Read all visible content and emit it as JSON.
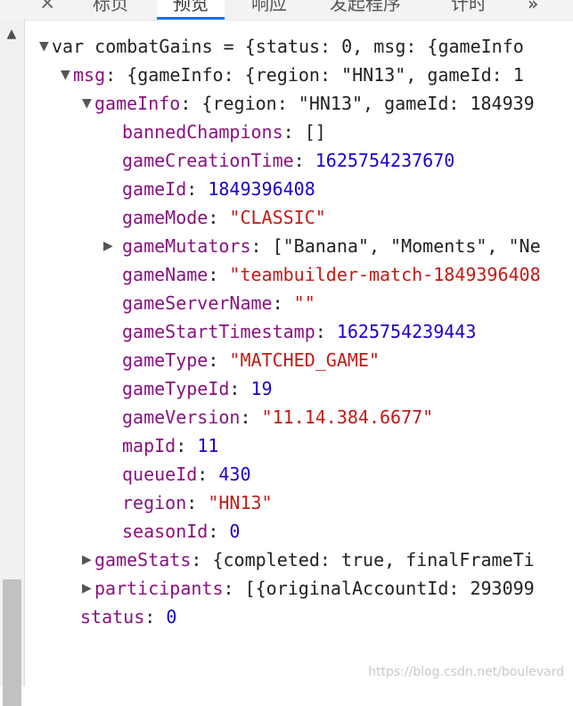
{
  "tabs": {
    "close_glyph": "×",
    "items": [
      "标页",
      "预览",
      "响应",
      "发起程序",
      "计时"
    ],
    "more_glyph": "»"
  },
  "scroll": {
    "up_glyph": "▲"
  },
  "console": {
    "root_line": "var combatGains = {status: 0, msg: {gameInfo",
    "msg": {
      "key": "msg",
      "preview": "{gameInfo: {region: \"HN13\", gameId: 1"
    },
    "gameInfo": {
      "key": "gameInfo",
      "preview": "{region: \"HN13\", gameId: 184939"
    },
    "fields": [
      {
        "key": "bannedChampions",
        "value": "[]",
        "kind": "plain"
      },
      {
        "key": "gameCreationTime",
        "value": "1625754237670",
        "kind": "num"
      },
      {
        "key": "gameId",
        "value": "1849396408",
        "kind": "num"
      },
      {
        "key": "gameMode",
        "value": "\"CLASSIC\"",
        "kind": "str"
      },
      {
        "key": "gameMutators",
        "value": "[\"Banana\", \"Moments\", \"Ne",
        "kind": "plain",
        "expandable": true
      },
      {
        "key": "gameName",
        "value": "\"teambuilder-match-1849396408",
        "kind": "str"
      },
      {
        "key": "gameServerName",
        "value": "\"\"",
        "kind": "str"
      },
      {
        "key": "gameStartTimestamp",
        "value": "1625754239443",
        "kind": "num"
      },
      {
        "key": "gameType",
        "value": "\"MATCHED_GAME\"",
        "kind": "str"
      },
      {
        "key": "gameTypeId",
        "value": "19",
        "kind": "num"
      },
      {
        "key": "gameVersion",
        "value": "\"11.14.384.6677\"",
        "kind": "str"
      },
      {
        "key": "mapId",
        "value": "11",
        "kind": "num"
      },
      {
        "key": "queueId",
        "value": "430",
        "kind": "num"
      },
      {
        "key": "region",
        "value": "\"HN13\"",
        "kind": "str"
      },
      {
        "key": "seasonId",
        "value": "0",
        "kind": "num"
      }
    ],
    "gameStats": {
      "key": "gameStats",
      "preview": "{completed: true, finalFrameTi"
    },
    "participants": {
      "key": "participants",
      "preview": "[{originalAccountId: 293099"
    },
    "status": {
      "key": "status",
      "value": "0"
    }
  },
  "watermark": "https://blog.csdn.net/boulevard"
}
